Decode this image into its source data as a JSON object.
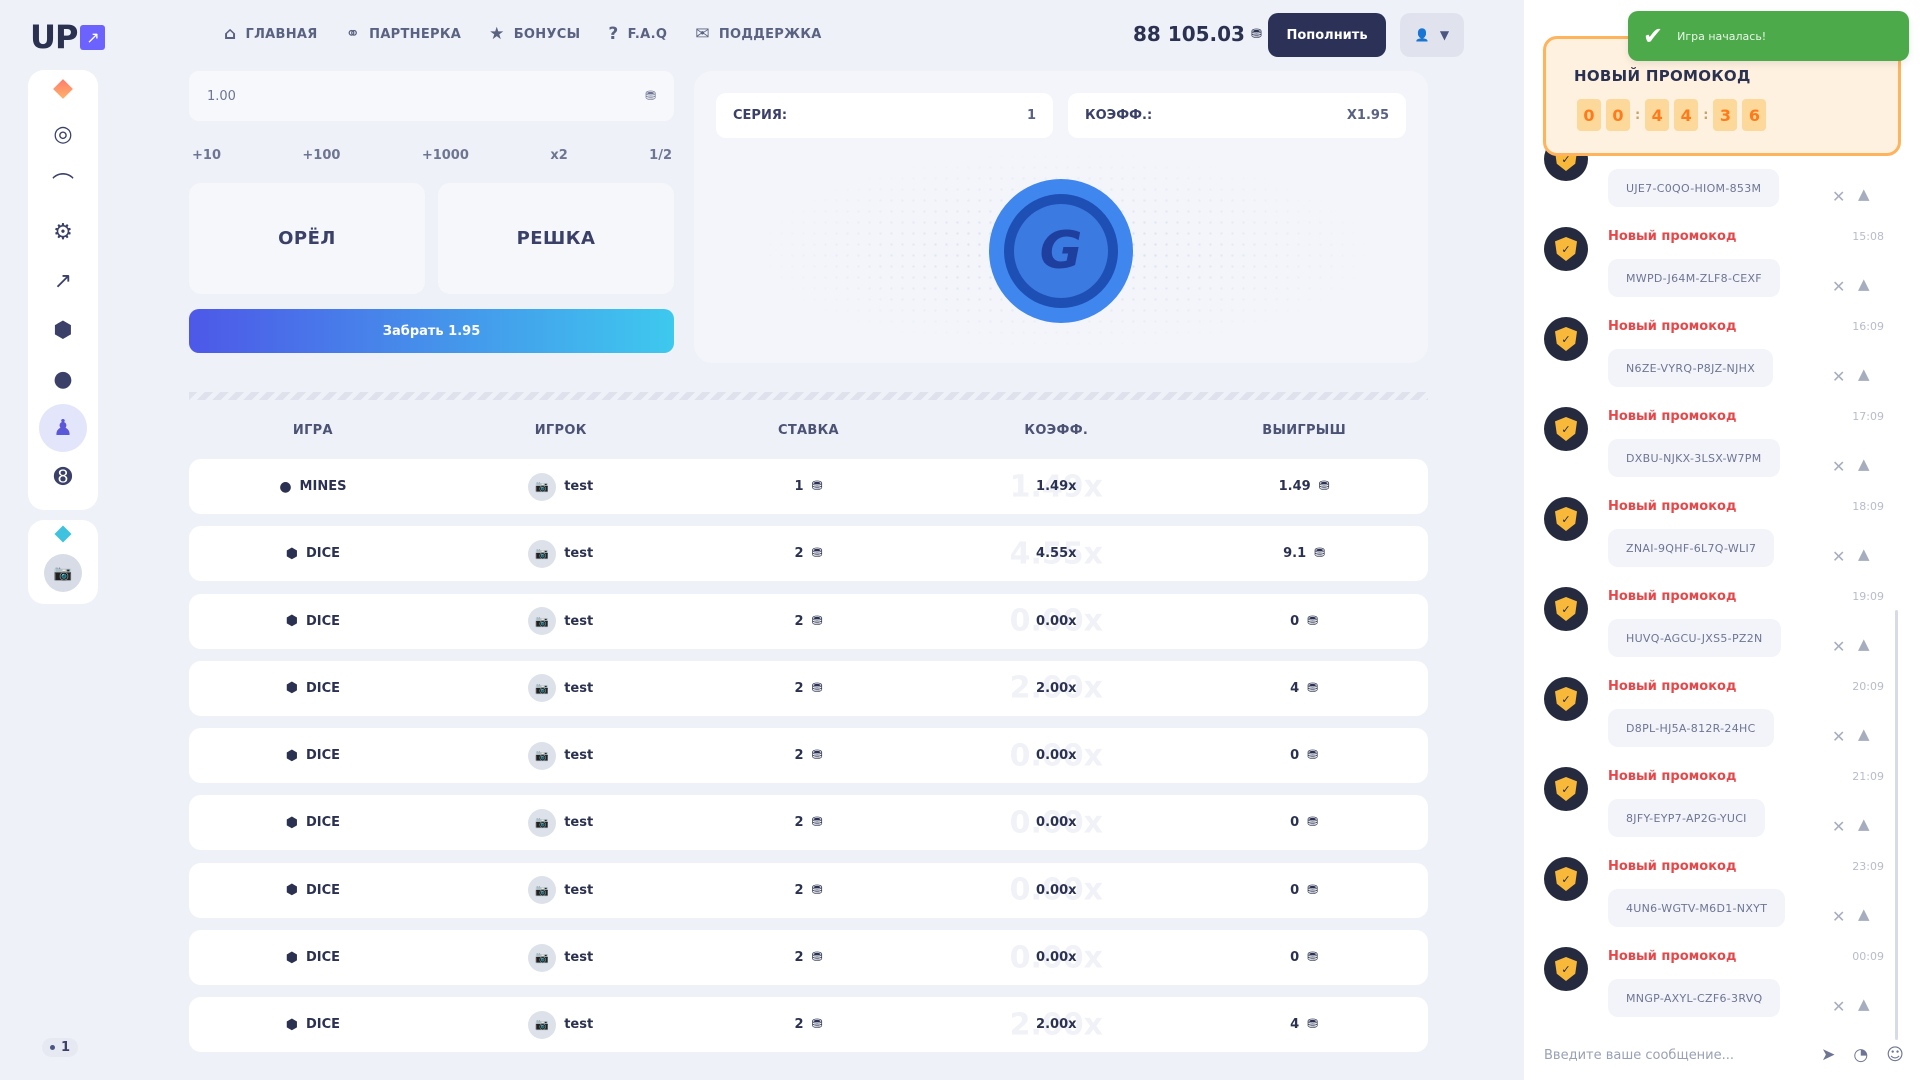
{
  "logo": {
    "text": "UP",
    "arrow": "↗"
  },
  "nav": [
    {
      "label": "ГЛАВНАЯ",
      "icon": "home-icon",
      "glyph": "⌂"
    },
    {
      "label": "ПАРТНЕРКА",
      "icon": "partners-icon",
      "glyph": "⚭"
    },
    {
      "label": "БОНУСЫ",
      "icon": "star-icon",
      "glyph": "★"
    },
    {
      "label": "F.A.Q",
      "icon": "question-icon",
      "glyph": "?"
    },
    {
      "label": "ПОДДЕРЖКА",
      "icon": "support-chat-icon",
      "glyph": "✉"
    }
  ],
  "balance": "88 105.03",
  "deposit_label": "Пополнить",
  "bet": {
    "value": "1.00",
    "quick": [
      "+10",
      "+100",
      "+1000",
      "x2",
      "1/2"
    ],
    "heads": "ОРЁЛ",
    "tails": "РЕШКА",
    "cashout": "Забрать 1.95"
  },
  "game": {
    "series_label": "СЕРИЯ:",
    "series_value": "1",
    "koef_label": "КОЭФФ.:",
    "koef_value": "X1.95",
    "coin_letter": "G"
  },
  "table": {
    "headers": [
      "ИГРА",
      "ИГРОК",
      "СТАВКА",
      "КОЭФФ.",
      "ВЫИГРЫШ"
    ],
    "rows": [
      {
        "game": "MINES",
        "icon": "bomb-icon",
        "player": "test",
        "bet": "1",
        "koef": "1.49x",
        "ghost": "1.49x",
        "win": "1.49"
      },
      {
        "game": "DICE",
        "icon": "dice-icon",
        "player": "test",
        "bet": "2",
        "koef": "4.55x",
        "ghost": "4.55x",
        "win": "9.1"
      },
      {
        "game": "DICE",
        "icon": "dice-icon",
        "player": "test",
        "bet": "2",
        "koef": "0.00x",
        "ghost": "0.00x",
        "win": "0"
      },
      {
        "game": "DICE",
        "icon": "dice-icon",
        "player": "test",
        "bet": "2",
        "koef": "2.00x",
        "ghost": "2.00x",
        "win": "4"
      },
      {
        "game": "DICE",
        "icon": "dice-icon",
        "player": "test",
        "bet": "2",
        "koef": "0.00x",
        "ghost": "0.00x",
        "win": "0"
      },
      {
        "game": "DICE",
        "icon": "dice-icon",
        "player": "test",
        "bet": "2",
        "koef": "0.00x",
        "ghost": "0.00x",
        "win": "0"
      },
      {
        "game": "DICE",
        "icon": "dice-icon",
        "player": "test",
        "bet": "2",
        "koef": "0.00x",
        "ghost": "0.00x",
        "win": "0"
      },
      {
        "game": "DICE",
        "icon": "dice-icon",
        "player": "test",
        "bet": "2",
        "koef": "0.00x",
        "ghost": "0.00x",
        "win": "0"
      },
      {
        "game": "DICE",
        "icon": "dice-icon",
        "player": "test",
        "bet": "2",
        "koef": "2.00x",
        "ghost": "2.00x",
        "win": "4"
      }
    ]
  },
  "online": "1",
  "promo": {
    "title": "НОВЫЙ ПРОМОКОД",
    "digits": [
      "0",
      "0",
      "4",
      "4",
      "3",
      "6"
    ]
  },
  "toast": "Игра началась!",
  "chat": {
    "messages": [
      {
        "name": "",
        "time": "",
        "code": "UJE7-C0QO-HIOM-853M"
      },
      {
        "name": "Новый промокод",
        "time": "15:08",
        "code": "MWPD-J64M-ZLF8-CEXF"
      },
      {
        "name": "Новый промокод",
        "time": "16:09",
        "code": "N6ZE-VYRQ-P8JZ-NJHX"
      },
      {
        "name": "Новый промокод",
        "time": "17:09",
        "code": "DXBU-NJKX-3LSX-W7PM"
      },
      {
        "name": "Новый промокод",
        "time": "18:09",
        "code": "ZNAI-9QHF-6L7Q-WLI7"
      },
      {
        "name": "Новый промокод",
        "time": "19:09",
        "code": "HUVQ-AGCU-JXS5-PZ2N"
      },
      {
        "name": "Новый промокод",
        "time": "20:09",
        "code": "D8PL-HJ5A-812R-24HC"
      },
      {
        "name": "Новый промокод",
        "time": "21:09",
        "code": "8JFY-EYP7-AP2G-YUCI"
      },
      {
        "name": "Новый промокод",
        "time": "23:09",
        "code": "4UN6-WGTV-M6D1-NXYT"
      },
      {
        "name": "Новый промокод",
        "time": "00:09",
        "code": "MNGP-AXYL-CZF6-3RVQ"
      }
    ],
    "placeholder": "Введите ваше сообщение..."
  }
}
